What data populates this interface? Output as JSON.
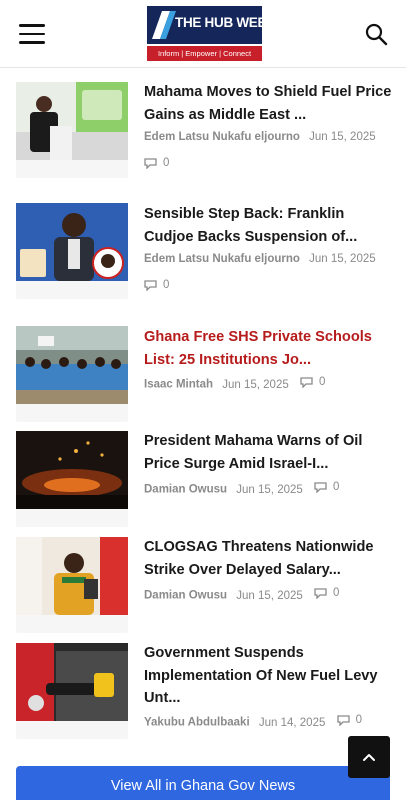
{
  "header": {
    "logo_title": "THE HUB WEB",
    "logo_tagline": "Inform | Empower | Connect",
    "menu_icon": "hamburger-menu-icon",
    "search_icon": "search-icon"
  },
  "articles": [
    {
      "title": "Mahama Moves to Shield Fuel Price Gains as Middle East ...",
      "author": "Edem Latsu Nukafu eljourno",
      "date": "Jun 15, 2025",
      "comments": "0",
      "highlight": false
    },
    {
      "title": "Sensible Step Back: Franklin Cudjoe Backs Suspension of...",
      "author": "Edem Latsu Nukafu eljourno",
      "date": "Jun 15, 2025",
      "comments": "0",
      "highlight": false
    },
    {
      "title": "Ghana Free SHS Private Schools List: 25 Institutions Jo...",
      "author": "Isaac Mintah",
      "date": "Jun 15, 2025",
      "comments": "0",
      "highlight": true
    },
    {
      "title": "President Mahama Warns of Oil Price Surge Amid Israel-I...",
      "author": "Damian Owusu",
      "date": "Jun 15, 2025",
      "comments": "0",
      "highlight": false
    },
    {
      "title": "CLOGSAG Threatens Nationwide Strike Over Delayed Salary...",
      "author": "Damian Owusu",
      "date": "Jun 15, 2025",
      "comments": "0",
      "highlight": false
    },
    {
      "title": "Government Suspends Implementation Of New Fuel Levy Unt...",
      "author": "Yakubu Abdulbaaki",
      "date": "Jun 14, 2025",
      "comments": "0",
      "highlight": false
    }
  ],
  "footer": {
    "view_all_label": "View All in Ghana Gov News",
    "scroll_top_icon": "chevron-up-icon"
  },
  "colors": {
    "accent_blue": "#2f67e0",
    "highlight_red": "#b71c1c",
    "logo_navy": "#14265a",
    "logo_red": "#c8202a"
  }
}
